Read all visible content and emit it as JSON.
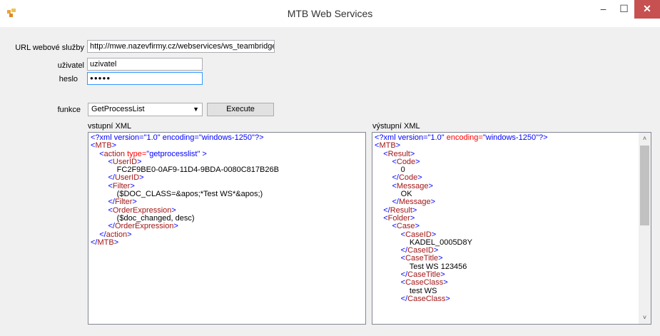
{
  "window": {
    "title": "MTB Web Services",
    "minimize": "–",
    "maximize": "☐",
    "close": "✕"
  },
  "form": {
    "url_label": "URL webové služby",
    "url_value": "http://mwe.nazevfirmy.cz/webservices/ws_teambridge.asmx",
    "user_label": "uživatel",
    "user_value": "uzivatel",
    "password_label": "heslo",
    "password_value": "●●●●●",
    "function_label": "funkce",
    "function_value": "GetProcessList",
    "execute_label": "Execute",
    "input_xml_label": "vstupní XML",
    "output_xml_label": "výstupní XML"
  },
  "input_xml": [
    [
      {
        "t": "<?xml version=\"1.0\" encoding=\"windows-1250\"?>",
        "c": "xb"
      }
    ],
    [
      {
        "t": "<",
        "c": "xb"
      },
      {
        "t": "MTB",
        "c": "xe"
      },
      {
        "t": ">",
        "c": "xb"
      }
    ],
    [
      {
        "t": "    <",
        "c": "xb"
      },
      {
        "t": "action",
        "c": "xe"
      },
      {
        "t": " type=",
        "c": "xa"
      },
      {
        "t": "\"getprocesslist\"",
        "c": "xb"
      },
      {
        "t": " >",
        "c": "xb"
      }
    ],
    [
      {
        "t": "        <",
        "c": "xb"
      },
      {
        "t": "UserID",
        "c": "xe"
      },
      {
        "t": ">",
        "c": "xb"
      }
    ],
    [
      {
        "t": "            FC2F9BE0-0AF9-11D4-9BDA-0080C817B26B",
        "c": "xt"
      }
    ],
    [
      {
        "t": "        </",
        "c": "xb"
      },
      {
        "t": "UserID",
        "c": "xe"
      },
      {
        "t": ">",
        "c": "xb"
      }
    ],
    [
      {
        "t": "        <",
        "c": "xb"
      },
      {
        "t": "Filter",
        "c": "xe"
      },
      {
        "t": ">",
        "c": "xb"
      }
    ],
    [
      {
        "t": "            ($DOC_CLASS=&apos;*Test WS*&apos;)",
        "c": "xt"
      }
    ],
    [
      {
        "t": "        </",
        "c": "xb"
      },
      {
        "t": "Filter",
        "c": "xe"
      },
      {
        "t": ">",
        "c": "xb"
      }
    ],
    [
      {
        "t": "        <",
        "c": "xb"
      },
      {
        "t": "OrderExpression",
        "c": "xe"
      },
      {
        "t": ">",
        "c": "xb"
      }
    ],
    [
      {
        "t": "            ($doc_changed, desc)",
        "c": "xt"
      }
    ],
    [
      {
        "t": "        </",
        "c": "xb"
      },
      {
        "t": "OrderExpression",
        "c": "xe"
      },
      {
        "t": ">",
        "c": "xb"
      }
    ],
    [
      {
        "t": "    </",
        "c": "xb"
      },
      {
        "t": "action",
        "c": "xe"
      },
      {
        "t": ">",
        "c": "xb"
      }
    ],
    [
      {
        "t": "</",
        "c": "xb"
      },
      {
        "t": "MTB",
        "c": "xe"
      },
      {
        "t": ">",
        "c": "xb"
      }
    ]
  ],
  "output_xml": [
    [
      {
        "t": "<?xml version=",
        "c": "xb"
      },
      {
        "t": "\"1.0\"",
        "c": "xb"
      },
      {
        "t": " encoding=",
        "c": "xa"
      },
      {
        "t": "\"windows-1250\"?>",
        "c": "xb"
      }
    ],
    [
      {
        "t": "<",
        "c": "xb"
      },
      {
        "t": "MTB",
        "c": "xe"
      },
      {
        "t": ">",
        "c": "xb"
      }
    ],
    [
      {
        "t": "    <",
        "c": "xb"
      },
      {
        "t": "Result",
        "c": "xe"
      },
      {
        "t": ">",
        "c": "xb"
      }
    ],
    [
      {
        "t": "        <",
        "c": "xb"
      },
      {
        "t": "Code",
        "c": "xe"
      },
      {
        "t": ">",
        "c": "xb"
      }
    ],
    [
      {
        "t": "            0",
        "c": "xt"
      }
    ],
    [
      {
        "t": "        </",
        "c": "xb"
      },
      {
        "t": "Code",
        "c": "xe"
      },
      {
        "t": ">",
        "c": "xb"
      }
    ],
    [
      {
        "t": "        <",
        "c": "xb"
      },
      {
        "t": "Message",
        "c": "xe"
      },
      {
        "t": ">",
        "c": "xb"
      }
    ],
    [
      {
        "t": "            OK",
        "c": "xt"
      }
    ],
    [
      {
        "t": "        </",
        "c": "xb"
      },
      {
        "t": "Message",
        "c": "xe"
      },
      {
        "t": ">",
        "c": "xb"
      }
    ],
    [
      {
        "t": "    </",
        "c": "xb"
      },
      {
        "t": "Result",
        "c": "xe"
      },
      {
        "t": ">",
        "c": "xb"
      }
    ],
    [
      {
        "t": "    <",
        "c": "xb"
      },
      {
        "t": "Folder",
        "c": "xe"
      },
      {
        "t": ">",
        "c": "xb"
      }
    ],
    [
      {
        "t": "        <",
        "c": "xb"
      },
      {
        "t": "Case",
        "c": "xe"
      },
      {
        "t": ">",
        "c": "xb"
      }
    ],
    [
      {
        "t": "            <",
        "c": "xb"
      },
      {
        "t": "CaseID",
        "c": "xe"
      },
      {
        "t": ">",
        "c": "xb"
      }
    ],
    [
      {
        "t": "                KADEL_0005D8Y",
        "c": "xt"
      }
    ],
    [
      {
        "t": "            </",
        "c": "xb"
      },
      {
        "t": "CaseID",
        "c": "xe"
      },
      {
        "t": ">",
        "c": "xb"
      }
    ],
    [
      {
        "t": "            <",
        "c": "xb"
      },
      {
        "t": "CaseTitle",
        "c": "xe"
      },
      {
        "t": ">",
        "c": "xb"
      }
    ],
    [
      {
        "t": "                Test WS 123456",
        "c": "xt"
      }
    ],
    [
      {
        "t": "            </",
        "c": "xb"
      },
      {
        "t": "CaseTitle",
        "c": "xe"
      },
      {
        "t": ">",
        "c": "xb"
      }
    ],
    [
      {
        "t": "            <",
        "c": "xb"
      },
      {
        "t": "CaseClass",
        "c": "xe"
      },
      {
        "t": ">",
        "c": "xb"
      }
    ],
    [
      {
        "t": "                test WS",
        "c": "xt"
      }
    ],
    [
      {
        "t": "            </",
        "c": "xb"
      },
      {
        "t": "CaseClass",
        "c": "xe"
      },
      {
        "t": ">",
        "c": "xb"
      }
    ]
  ],
  "output_scroll": {
    "up": "˄",
    "down": "˅"
  },
  "colors": {
    "xml_bracket": "#0000ff",
    "xml_element": "#a31515",
    "xml_attribute": "#ff0000",
    "close_button": "#c75050"
  }
}
